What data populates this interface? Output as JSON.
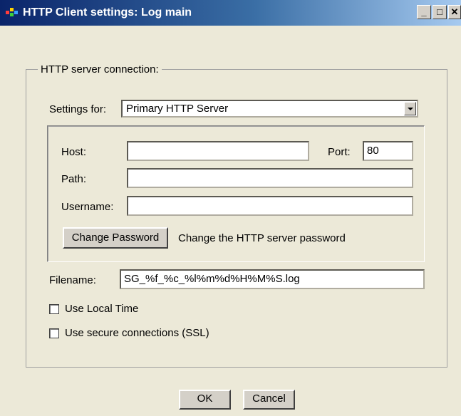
{
  "window": {
    "title": "HTTP Client settings: Log main",
    "minimize_glyph": "_",
    "maximize_glyph": "□",
    "close_glyph": "✕"
  },
  "group": {
    "legend": "HTTP server connection:"
  },
  "settings_for": {
    "label": "Settings for:",
    "selected": "Primary HTTP Server"
  },
  "host": {
    "label": "Host:",
    "value": ""
  },
  "port": {
    "label": "Port:",
    "value": "80"
  },
  "path": {
    "label": "Path:",
    "value": ""
  },
  "username": {
    "label": "Username:",
    "value": ""
  },
  "password": {
    "button_label": "Change Password",
    "description": "Change the HTTP server password"
  },
  "filename": {
    "label": "Filename:",
    "value": "SG_%f_%c_%l%m%d%H%M%S.log"
  },
  "use_local_time": {
    "label": "Use Local Time",
    "checked": false
  },
  "use_ssl": {
    "label": "Use secure connections (SSL)",
    "checked": false
  },
  "footer": {
    "ok_label": "OK",
    "cancel_label": "Cancel"
  }
}
